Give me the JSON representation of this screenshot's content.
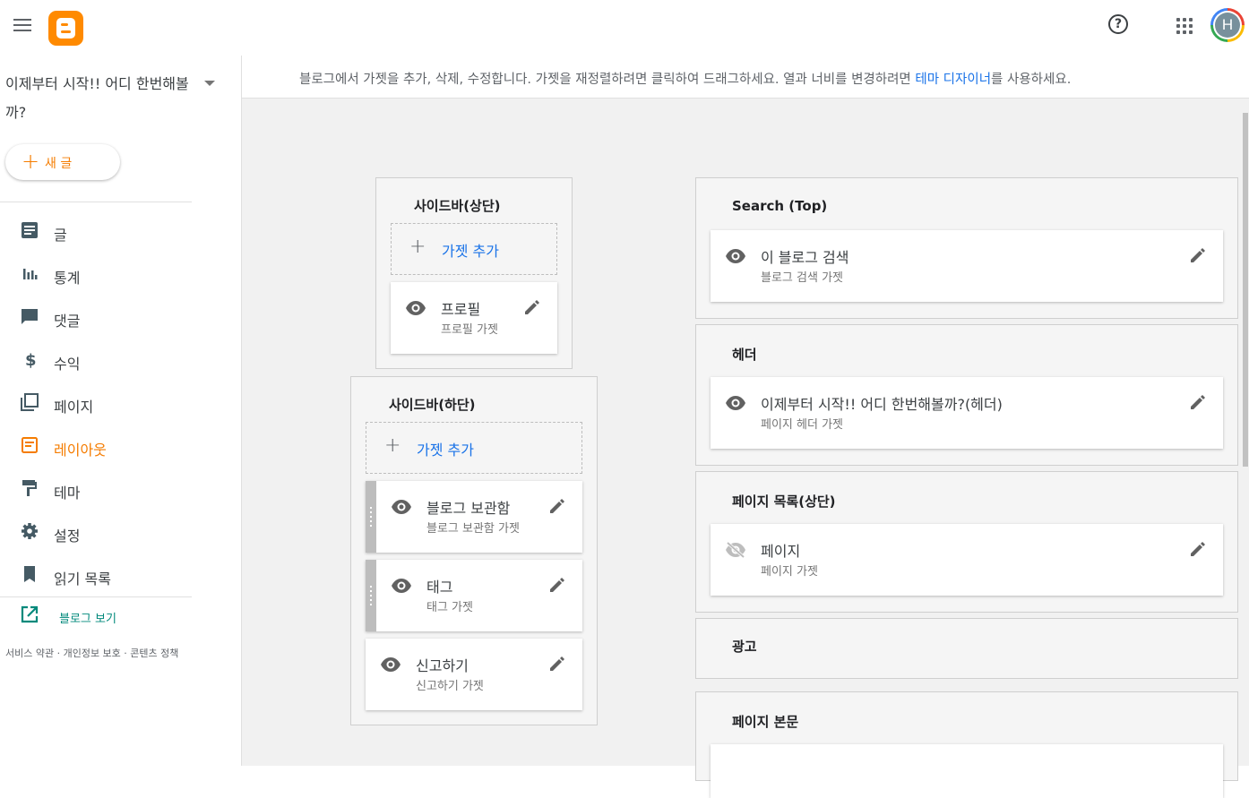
{
  "topbar": {
    "help_glyph": "?",
    "avatar_initial": "H"
  },
  "sidebar": {
    "blog_title": "이제부터 시작!! 어디 한번해볼까?",
    "new_post_label": "새 글",
    "nav": [
      {
        "label": "글",
        "icon": "posts-icon"
      },
      {
        "label": "통계",
        "icon": "stats-icon"
      },
      {
        "label": "댓글",
        "icon": "comments-icon"
      },
      {
        "label": "수익",
        "icon": "earnings-icon"
      },
      {
        "label": "페이지",
        "icon": "pages-icon"
      },
      {
        "label": "레이아웃",
        "icon": "layout-icon",
        "active": true
      },
      {
        "label": "테마",
        "icon": "theme-icon"
      },
      {
        "label": "설정",
        "icon": "settings-icon"
      },
      {
        "label": "읽기 목록",
        "icon": "reading-list-icon"
      }
    ],
    "view_blog_label": "블로그 보기",
    "footer": "서비스 약관 · 개인정보 보호 · 콘텐츠 정책"
  },
  "infobar": {
    "text_before": "블로그에서 가젯을 추가, 삭제, 수정합니다. 가젯을 재정렬하려면 클릭하여 드래그하세요. 열과 너비를 변경하려면 ",
    "link": "테마 디자이너",
    "text_after": "를 사용하세요."
  },
  "layout": {
    "sidebar_top": {
      "title": "사이드바(상단)",
      "add_label": "가젯 추가",
      "gadgets": [
        {
          "name": "프로필",
          "sub": "프로필 가젯"
        }
      ]
    },
    "sidebar_bottom": {
      "title": "사이드바(하단)",
      "add_label": "가젯 추가",
      "gadgets": [
        {
          "name": "블로그 보관함",
          "sub": "블로그 보관함 가젯"
        },
        {
          "name": "태그",
          "sub": "태그 가젯"
        },
        {
          "name": "신고하기",
          "sub": "신고하기 가젯"
        }
      ]
    },
    "search_top": {
      "title": "Search (Top)",
      "gadget": {
        "name": "이 블로그 검색",
        "sub": "블로그 검색 가젯"
      }
    },
    "header": {
      "title": "헤더",
      "gadget": {
        "name": "이제부터 시작!! 어디 한번해볼까?(헤더)",
        "sub": "페이지 헤더 가젯"
      }
    },
    "page_list_top": {
      "title": "페이지 목록(상단)",
      "gadget": {
        "name": "페이지",
        "sub": "페이지 가젯",
        "hidden": true
      }
    },
    "ads": {
      "title": "광고"
    },
    "page_body": {
      "title": "페이지 본문"
    }
  },
  "colors": {
    "accent": "#f57c00",
    "link": "#1a73e8",
    "teal": "#00897b",
    "logo": "#ff8a00"
  }
}
